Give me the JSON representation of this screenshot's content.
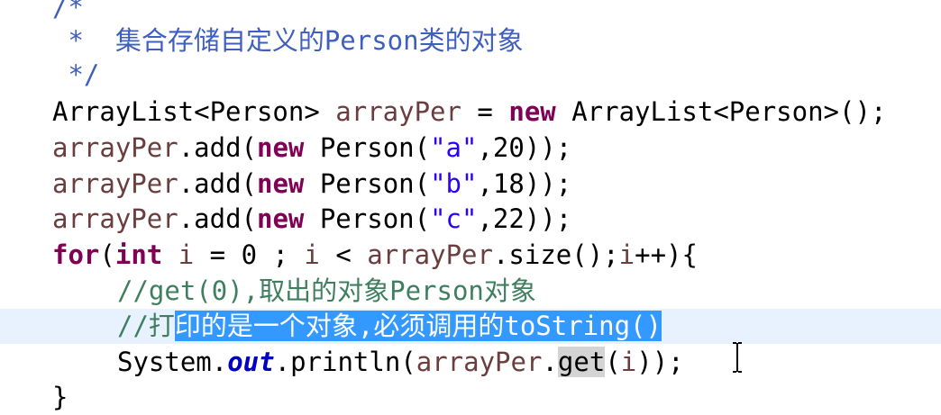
{
  "editor": {
    "lines": [
      {
        "indent": "  ",
        "tokens": [
          {
            "t": "/*",
            "c": "jdoc"
          }
        ]
      },
      {
        "indent": "  ",
        "tokens": [
          {
            "t": " *  集合存储自定义的Person类的对象",
            "c": "jdoc"
          }
        ]
      },
      {
        "indent": "  ",
        "tokens": [
          {
            "t": " */",
            "c": "jdoc"
          }
        ]
      },
      {
        "indent": "  ",
        "tokens": [
          {
            "t": "ArrayList<Person> ",
            "c": "plain"
          },
          {
            "t": "arrayPer",
            "c": "var"
          },
          {
            "t": " = ",
            "c": "plain"
          },
          {
            "t": "new",
            "c": "kw"
          },
          {
            "t": " ArrayList<Person>();",
            "c": "plain"
          }
        ]
      },
      {
        "indent": "  ",
        "tokens": [
          {
            "t": "arrayPer",
            "c": "var"
          },
          {
            "t": ".add(",
            "c": "plain"
          },
          {
            "t": "new",
            "c": "kw"
          },
          {
            "t": " Person(",
            "c": "plain"
          },
          {
            "t": "\"a\"",
            "c": "str"
          },
          {
            "t": ",20));",
            "c": "plain"
          }
        ]
      },
      {
        "indent": "  ",
        "tokens": [
          {
            "t": "arrayPer",
            "c": "var"
          },
          {
            "t": ".add(",
            "c": "plain"
          },
          {
            "t": "new",
            "c": "kw"
          },
          {
            "t": " Person(",
            "c": "plain"
          },
          {
            "t": "\"b\"",
            "c": "str"
          },
          {
            "t": ",18));",
            "c": "plain"
          }
        ]
      },
      {
        "indent": "  ",
        "tokens": [
          {
            "t": "arrayPer",
            "c": "var"
          },
          {
            "t": ".add(",
            "c": "plain"
          },
          {
            "t": "new",
            "c": "kw"
          },
          {
            "t": " Person(",
            "c": "plain"
          },
          {
            "t": "\"c\"",
            "c": "str"
          },
          {
            "t": ",22));",
            "c": "plain"
          }
        ]
      },
      {
        "indent": "  ",
        "tokens": [
          {
            "t": "for",
            "c": "kw"
          },
          {
            "t": "(",
            "c": "plain"
          },
          {
            "t": "int",
            "c": "kw"
          },
          {
            "t": " ",
            "c": "plain"
          },
          {
            "t": "i",
            "c": "var"
          },
          {
            "t": " = 0 ; ",
            "c": "plain"
          },
          {
            "t": "i",
            "c": "var"
          },
          {
            "t": " < ",
            "c": "plain"
          },
          {
            "t": "arrayPer",
            "c": "var"
          },
          {
            "t": ".size();",
            "c": "plain"
          },
          {
            "t": "i",
            "c": "var"
          },
          {
            "t": "++){",
            "c": "plain"
          }
        ]
      },
      {
        "indent": "      ",
        "tokens": [
          {
            "t": "//get(0),取出的对象Person对象",
            "c": "cmt"
          }
        ]
      },
      {
        "indent": "      ",
        "current": true,
        "tokens": [
          {
            "t": "//打",
            "c": "cmt"
          },
          {
            "t": "印的是一个对象,必须调用的toString()",
            "c": "sel"
          }
        ]
      },
      {
        "indent": "      ",
        "tokens": [
          {
            "t": "System.",
            "c": "plain"
          },
          {
            "t": "out",
            "c": "field"
          },
          {
            "t": ".println(",
            "c": "plain"
          },
          {
            "t": "arrayPer",
            "c": "var"
          },
          {
            "t": ".",
            "c": "plain"
          },
          {
            "t": "get",
            "c": "occ"
          },
          {
            "t": "(",
            "c": "plain"
          },
          {
            "t": "i",
            "c": "var"
          },
          {
            "t": "));",
            "c": "plain"
          }
        ]
      },
      {
        "indent": "  ",
        "tokens": [
          {
            "t": "}",
            "c": "plain"
          }
        ]
      }
    ],
    "colors": {
      "keyword": "#7f0055",
      "variable": "#6a3e3e",
      "string": "#2a00ff",
      "comment": "#3f7f5f",
      "javadoc": "#3f5fbf",
      "selection": "#3399ff",
      "current_line": "#e8f2fe"
    },
    "cursor_icon": "text-ibeam-cursor-icon"
  }
}
